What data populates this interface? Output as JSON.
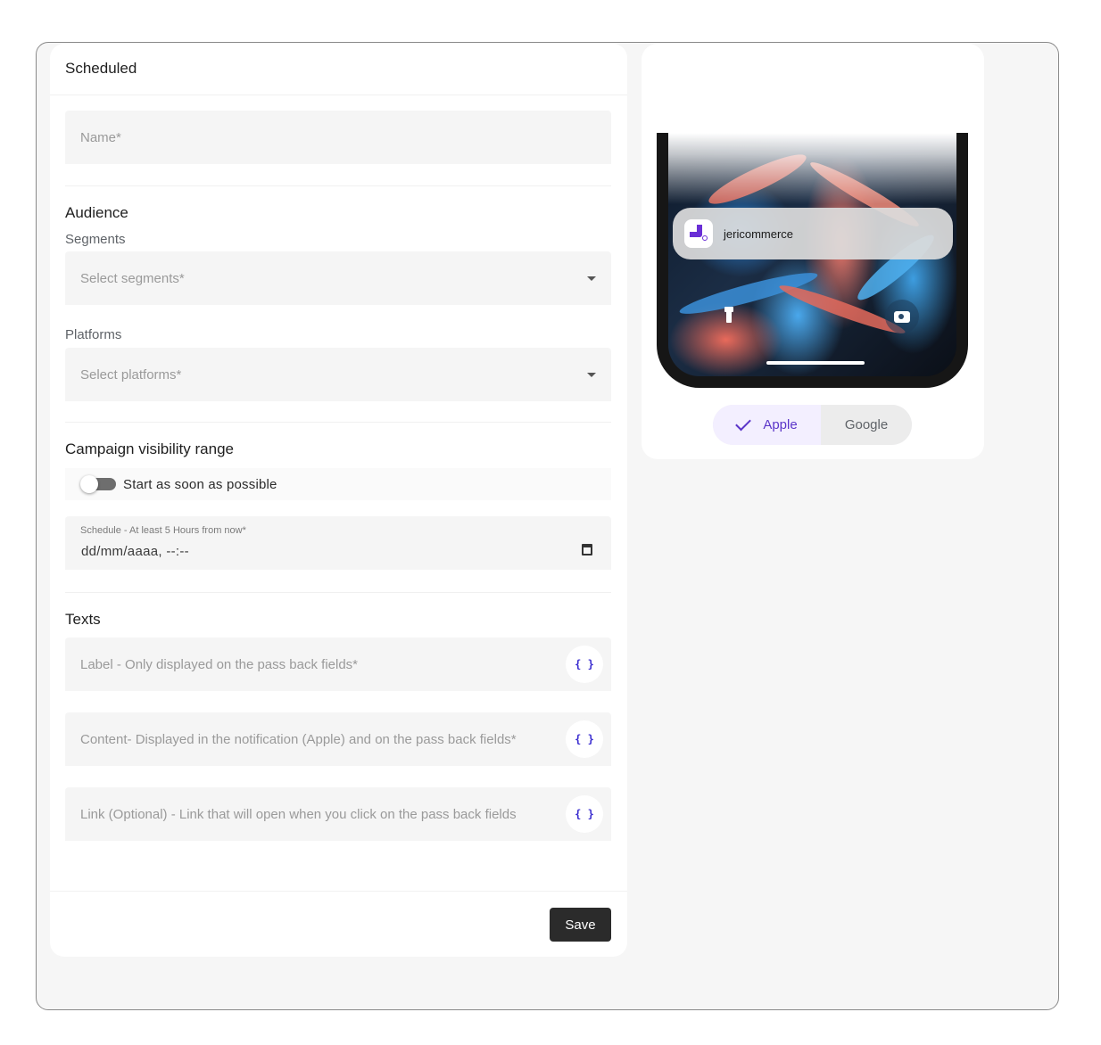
{
  "form": {
    "title": "Scheduled",
    "name_placeholder": "Name*",
    "audience": {
      "title": "Audience",
      "segments_label": "Segments",
      "segments_placeholder": "Select segments*",
      "platforms_label": "Platforms",
      "platforms_placeholder": "Select platforms*"
    },
    "visibility": {
      "title": "Campaign visibility range",
      "toggle_label": "Start as soon as possible",
      "toggle_on": false,
      "schedule_label": "Schedule - At least 5 Hours from now*",
      "schedule_value": "dd/mm/aaaa, --:--"
    },
    "texts": {
      "title": "Texts",
      "label_placeholder": "Label - Only displayed on the pass back fields*",
      "content_placeholder": "Content- Displayed in the notification (Apple) and on the pass back fields*",
      "link_placeholder": "Link (Optional) - Link that will open when you click on the pass back fields",
      "variable_button": "{ }"
    },
    "save_label": "Save"
  },
  "preview": {
    "notification_app": "jericommerce",
    "platforms": [
      {
        "label": "Apple",
        "selected": true
      },
      {
        "label": "Google",
        "selected": false
      }
    ],
    "accent_color": "#5b36c9"
  }
}
